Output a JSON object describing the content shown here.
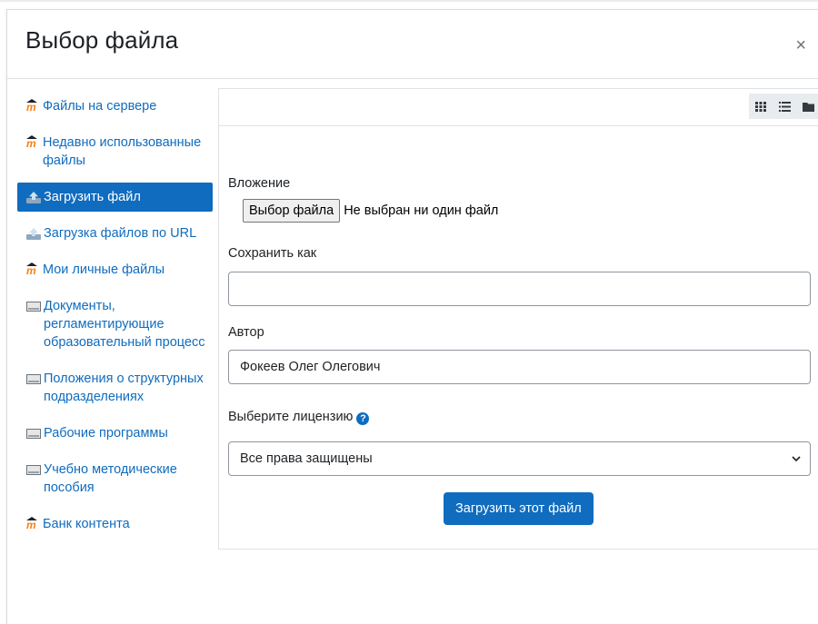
{
  "dialog": {
    "title": "Выбор файла",
    "close_label": "×"
  },
  "sidebar": {
    "items": [
      {
        "label": "Файлы на сервере",
        "icon": "moodle-icon",
        "active": false
      },
      {
        "label": "Недавно использованные файлы",
        "icon": "moodle-icon",
        "active": false
      },
      {
        "label": "Загрузить файл",
        "icon": "upload-icon",
        "active": true
      },
      {
        "label": "Загрузка файлов по URL",
        "icon": "url-download-icon",
        "active": false
      },
      {
        "label": "Мои личные файлы",
        "icon": "moodle-icon",
        "active": false
      },
      {
        "label": "Документы, регламентирующие образовательный процесс",
        "icon": "repository-icon",
        "active": false
      },
      {
        "label": "Положения о структурных подразделениях",
        "icon": "repository-icon",
        "active": false
      },
      {
        "label": "Рабочие программы",
        "icon": "repository-icon",
        "active": false
      },
      {
        "label": "Учебно методические пособия",
        "icon": "repository-icon",
        "active": false
      },
      {
        "label": "Банк контента",
        "icon": "moodle-icon",
        "active": false
      }
    ]
  },
  "toolbar": {
    "views": [
      "grid-view-icon",
      "list-view-icon",
      "folder-view-icon"
    ]
  },
  "form": {
    "attachment_label": "Вложение",
    "choose_file_button": "Выбор файла",
    "file_status": "Не выбран ни один файл",
    "save_as_label": "Сохранить как",
    "save_as_value": "",
    "author_label": "Автор",
    "author_value": "Фокеев Олег Олегович",
    "license_label": "Выберите лицензию",
    "license_value": "Все права защищены",
    "submit_button": "Загрузить этот файл"
  },
  "colors": {
    "accent": "#0f6cbf",
    "text": "#1d2125"
  }
}
